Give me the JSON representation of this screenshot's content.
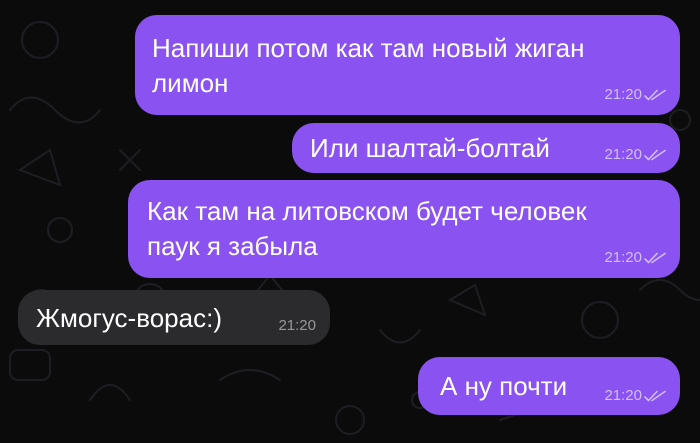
{
  "colors": {
    "background": "#0b0b0c",
    "outgoing_bubble": "#8a52f0",
    "incoming_bubble": "#2b2b2e",
    "text": "#ffffff"
  },
  "messages": [
    {
      "direction": "outgoing",
      "lines": [
        "Напиши потом как там новый жиган",
        "лимон"
      ],
      "time": "21:20",
      "status_icon": "double-check-icon"
    },
    {
      "direction": "outgoing",
      "lines": [
        "Или шалтай-болтай"
      ],
      "time": "21:20",
      "status_icon": "double-check-icon"
    },
    {
      "direction": "outgoing",
      "lines": [
        "Как там на литовском будет человек",
        "паук я забыла"
      ],
      "time": "21:20",
      "status_icon": "double-check-icon"
    },
    {
      "direction": "incoming",
      "lines": [
        "Жмогус-ворас:)"
      ],
      "time": "21:20"
    },
    {
      "direction": "outgoing",
      "lines": [
        "А ну почти"
      ],
      "time": "21:20",
      "status_icon": "double-check-icon"
    }
  ]
}
